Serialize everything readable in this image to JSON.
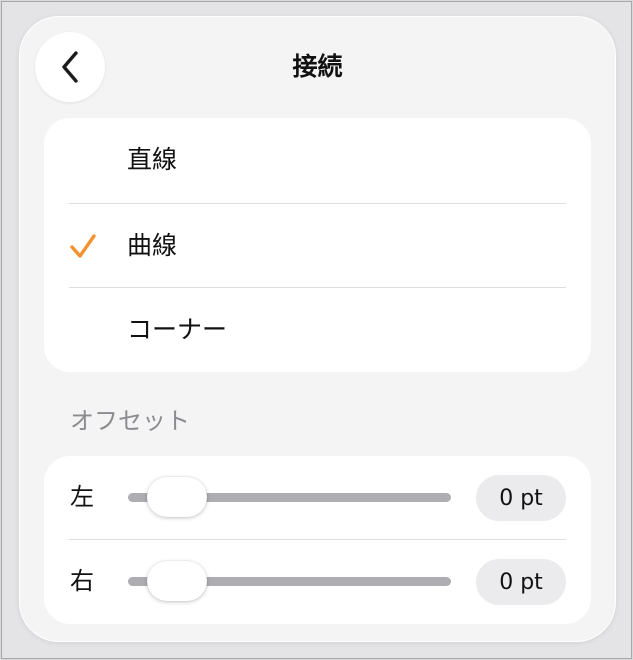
{
  "header": {
    "title": "接続",
    "back_icon": "chevron-left-icon"
  },
  "connection_options": {
    "items": [
      {
        "label": "直線",
        "selected": false
      },
      {
        "label": "曲線",
        "selected": true
      },
      {
        "label": "コーナー",
        "selected": false
      }
    ],
    "checkmark_icon": "checkmark-icon",
    "accent_color": "#f5922f"
  },
  "offset": {
    "section_label": "オフセット",
    "rows": [
      {
        "label": "左",
        "value_text": "0 pt",
        "value": 0
      },
      {
        "label": "右",
        "value_text": "0 pt",
        "value": 0
      }
    ]
  }
}
